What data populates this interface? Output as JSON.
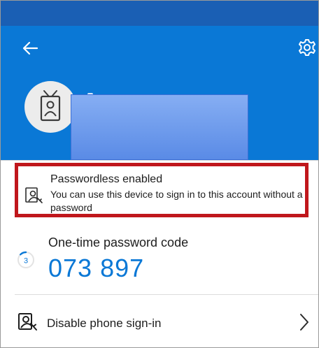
{
  "colors": {
    "statusbar": "#1a5fb4",
    "header": "#0a78d6",
    "highlight_border": "#c0171c",
    "code": "#0a78d6"
  },
  "header": {
    "back_icon": "arrow-left-icon",
    "settings_icon": "gear-icon",
    "avatar_icon": "id-badge-icon"
  },
  "passwordless": {
    "icon": "passwordless-person-key-icon",
    "title": "Passwordless enabled",
    "description": "You can use this device to sign in to this account without a password"
  },
  "otp": {
    "label": "One-time password code",
    "code": "073 897",
    "timer_seconds": "3"
  },
  "phone_signin": {
    "icon": "phone-signin-icon",
    "label": "Disable phone sign-in",
    "chevron": "chevron-right-icon"
  }
}
